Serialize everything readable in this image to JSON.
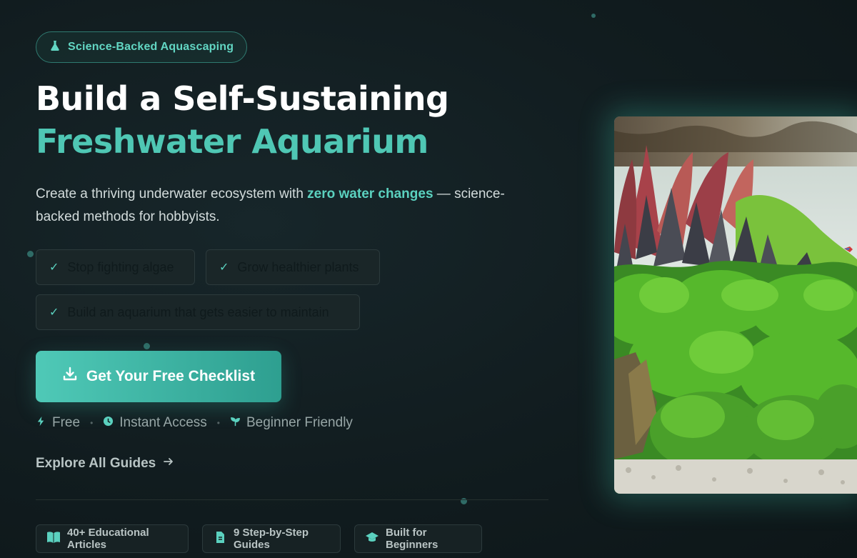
{
  "badge": {
    "icon": "flask-icon",
    "label": "Science-Backed Aquascaping"
  },
  "hero": {
    "title_line1": "Build a Self-Sustaining",
    "title_line2": "Freshwater Aquarium",
    "subtitle_before": "Create a thriving underwater ecosystem with ",
    "subtitle_highlight": "zero water changes",
    "subtitle_after": " — science-backed methods for hobbyists."
  },
  "benefits": [
    {
      "label": "Stop fighting algae"
    },
    {
      "label": "Grow healthier plants"
    },
    {
      "label": "Build an aquarium that gets easier to maintain"
    }
  ],
  "cta": {
    "icon": "download-icon",
    "label": "Get Your Free Checklist"
  },
  "meta": [
    {
      "icon": "bolt-icon",
      "label": "Free"
    },
    {
      "icon": "clock-icon",
      "label": "Instant Access"
    },
    {
      "icon": "sprout-icon",
      "label": "Beginner Friendly"
    }
  ],
  "explore": {
    "label": "Explore All Guides",
    "icon": "arrow-right-icon"
  },
  "stats": [
    {
      "icon": "book-icon",
      "label": "40+ Educational Articles"
    },
    {
      "icon": "document-icon",
      "label": "9 Step-by-Step Guides"
    },
    {
      "icon": "graduation-cap-icon",
      "label": "Built for Beginners"
    }
  ],
  "image": {
    "subject": "aquascape-aquarium-photo"
  },
  "colors": {
    "accent": "#4fc7b4",
    "background": "#111c1f"
  }
}
